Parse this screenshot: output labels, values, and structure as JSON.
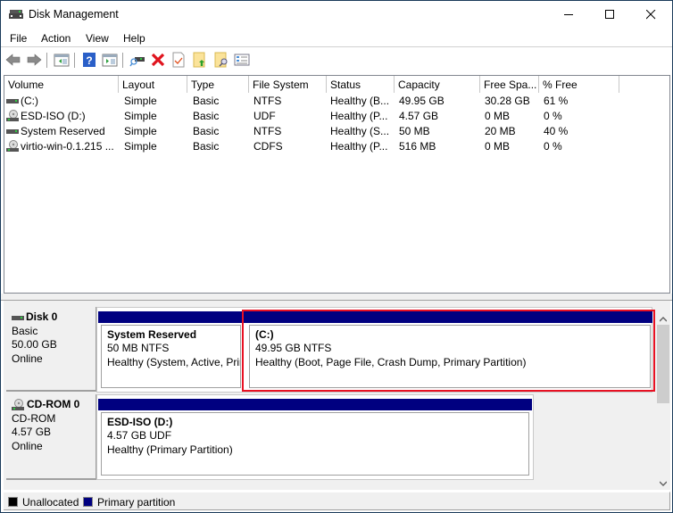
{
  "window": {
    "title": "Disk Management",
    "controls": {
      "minimize": "minimize",
      "maximize": "maximize",
      "close": "close"
    }
  },
  "menu": [
    "File",
    "Action",
    "View",
    "Help"
  ],
  "toolbar": {
    "buttons": [
      "back-icon",
      "forward-icon",
      "show-hide-console-tree-icon",
      "help-icon",
      "show-hide-action-pane-icon",
      "connect-drive-icon",
      "delete-icon",
      "check-icon",
      "folder-up-icon",
      "folder-search-icon",
      "properties-icon"
    ]
  },
  "volume_list": {
    "columns": [
      "Volume",
      "Layout",
      "Type",
      "File System",
      "Status",
      "Capacity",
      "Free Spa...",
      "% Free"
    ],
    "rows": [
      {
        "icon": "disk-icon",
        "volume": " (C:)",
        "layout": "Simple",
        "type": "Basic",
        "fs": "NTFS",
        "status": "Healthy (B...",
        "capacity": "49.95 GB",
        "free": "30.28 GB",
        "pct": "61 %"
      },
      {
        "icon": "cdrom-icon",
        "volume": "ESD-ISO (D:)",
        "layout": "Simple",
        "type": "Basic",
        "fs": "UDF",
        "status": "Healthy (P...",
        "capacity": "4.57 GB",
        "free": "0 MB",
        "pct": "0 %"
      },
      {
        "icon": "disk-icon",
        "volume": "System Reserved",
        "layout": "Simple",
        "type": "Basic",
        "fs": "NTFS",
        "status": "Healthy (S...",
        "capacity": "50 MB",
        "free": "20 MB",
        "pct": "40 %"
      },
      {
        "icon": "cdrom-icon",
        "volume": "virtio-win-0.1.215 ...",
        "layout": "Simple",
        "type": "Basic",
        "fs": "CDFS",
        "status": "Healthy (P...",
        "capacity": "516 MB",
        "free": "0 MB",
        "pct": "0 %"
      }
    ]
  },
  "disks": [
    {
      "name": "Disk 0",
      "type": "Basic",
      "size": "50.00 GB",
      "state": "Online",
      "partitions": [
        {
          "name": "System Reserved",
          "size": "50 MB NTFS",
          "status": "Healthy (System, Active, Prir"
        },
        {
          "name": " (C:)",
          "size": "49.95 GB NTFS",
          "status": "Healthy (Boot, Page File, Crash Dump, Primary Partition)",
          "selected": true
        }
      ]
    },
    {
      "name": "CD-ROM 0",
      "type": "CD-ROM",
      "size": "4.57 GB",
      "state": "Online",
      "partitions": [
        {
          "name": "ESD-ISO  (D:)",
          "size": "4.57 GB UDF",
          "status": "Healthy (Primary Partition)"
        }
      ]
    }
  ],
  "legend": [
    {
      "label": "Unallocated",
      "color": "#000000"
    },
    {
      "label": "Primary partition",
      "color": "#000080"
    }
  ],
  "colors": {
    "primary_partition": "#000080",
    "selection": "#e81123"
  }
}
